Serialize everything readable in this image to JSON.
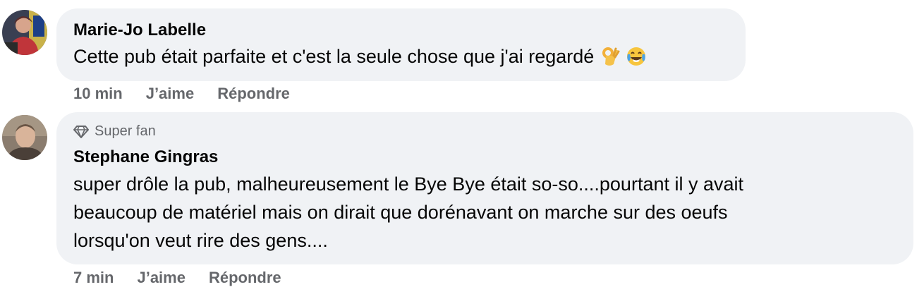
{
  "comments": [
    {
      "author": "Marie-Jo Labelle",
      "lines": [
        "Cette pub était parfaite et c'est la seule chose que j'ai regardé"
      ],
      "emojis": [
        "ok-hand-emoji",
        "tears-of-joy-emoji"
      ],
      "time": "10 min",
      "like_label": "J’aime",
      "reply_label": "Répondre"
    },
    {
      "badge": "Super fan",
      "badge_icon": "diamond-icon",
      "author": "Stephane Gingras",
      "lines": [
        "super drôle la pub, malheureusement le Bye Bye était so-so....pourtant il y avait",
        "beaucoup de matériel mais on dirait que dorénavant on marche sur des oeufs",
        "lorsqu'on veut rire des gens...."
      ],
      "time": "7 min",
      "like_label": "J’aime",
      "reply_label": "Répondre"
    }
  ],
  "colors": {
    "bubble": "#f0f2f5",
    "text": "#050505",
    "secondary": "#65676b"
  }
}
